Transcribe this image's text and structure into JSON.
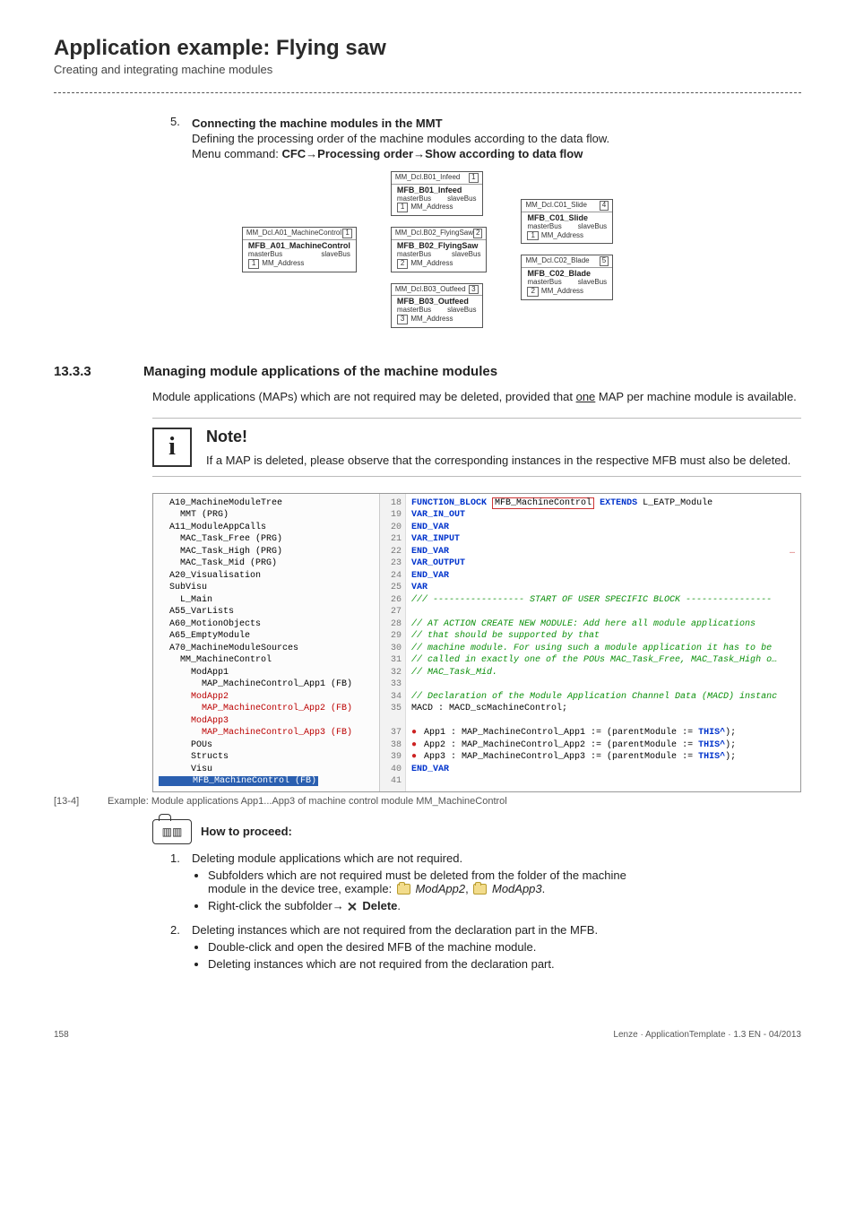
{
  "header": {
    "title": "Application example: Flying saw",
    "subtitle": "Creating and integrating machine modules"
  },
  "steps": {
    "step5": {
      "num": "5.",
      "title": "Connecting the machine modules in the MMT",
      "line1": "Defining the processing order of the machine modules according to the data flow.",
      "line2_prefix": "Menu command: ",
      "line2_cmd": "CFC→Processing order→Show according to data flow"
    }
  },
  "diagram": {
    "blocks": [
      {
        "decl": "MM_Dcl.A01_MachineControl",
        "name": "MFB_A01_MachineControl",
        "idx": "1",
        "addr": "1"
      },
      {
        "decl": "MM_Dcl.B01_Infeed",
        "name": "MFB_B01_Infeed",
        "idx": "1",
        "addr": "1"
      },
      {
        "decl": "MM_Dcl.B02_FlyingSaw",
        "name": "MFB_B02_FlyingSaw",
        "idx": "2",
        "addr": "2"
      },
      {
        "decl": "MM_Dcl.B03_Outfeed",
        "name": "MFB_B03_Outfeed",
        "idx": "3",
        "addr": "3"
      },
      {
        "decl": "MM_Dcl.C01_Slide",
        "name": "MFB_C01_Slide",
        "idx": "4",
        "addr": "1"
      },
      {
        "decl": "MM_Dcl.C02_Blade",
        "name": "MFB_C02_Blade",
        "idx": "5",
        "addr": "2"
      }
    ],
    "port_left": "masterBus",
    "port_right": "slaveBus",
    "port_addr": "MM_Address"
  },
  "section": {
    "num": "13.3.3",
    "title": "Managing module applications of the machine modules",
    "body": "Module applications (MAPs) which are not required may be deleted, provided that one MAP per machine module is available."
  },
  "note": {
    "title": "Note!",
    "body": "If a MAP is deleted, please observe that the corresponding instances in the respective MFB must also be deleted."
  },
  "code_screenshot": {
    "tree": [
      "  A10_MachineModuleTree",
      "    MMT (PRG)",
      "  A11_ModuleAppCalls",
      "    MAC_Task_Free (PRG)",
      "    MAC_Task_High (PRG)",
      "    MAC_Task_Mid (PRG)",
      "  A20_Visualisation",
      "  SubVisu",
      "    L_Main",
      "  A55_VarLists",
      "  A60_MotionObjects",
      "  A65_EmptyModule",
      "  A70_MachineModuleSources",
      "    MM_MachineControl",
      "      ModApp1",
      "        MAP_MachineControl_App1 (FB)",
      "      ModApp2",
      "        MAP_MachineControl_App2 (FB)",
      "      ModApp3",
      "        MAP_MachineControl_App3 (FB)",
      "      POUs",
      "      Structs",
      "      Visu",
      "      MFB_MachineControl (FB)"
    ],
    "linenos": [
      "18",
      "19",
      "20",
      "21",
      "22",
      "23",
      "24",
      "25",
      "26",
      "27",
      "28",
      "29",
      "30",
      "31",
      "32",
      "33",
      "34",
      "35",
      "",
      "37",
      "38",
      "39",
      "40",
      "41"
    ],
    "code": [
      "FUNCTION_BLOCK MFB_MachineControl EXTENDS L_EATP_Module",
      "VAR_IN_OUT",
      "END_VAR",
      "VAR_INPUT",
      "END_VAR",
      "VAR_OUTPUT",
      "END_VAR",
      "VAR",
      "    /// ----------------- START OF USER SPECIFIC BLOCK  ----------------",
      "",
      "    //  AT ACTION CREATE NEW MODULE: Add here all module applications",
      "    //  that should be supported by that",
      "    //  machine module. For using such a module application it has to be",
      "    //  called in exactly one of the POUs MAC_Task_Free, MAC_Task_High o…",
      "    //  MAC_Task_Mid.",
      "",
      "    // Declaration of the Module Application Channel Data (MACD) instanc",
      "    MACD : MACD_scMachineControl;",
      "",
      "    App1      : MAP_MachineControl_App1 := (parentModule := THIS^);",
      "    App2      : MAP_MachineControl_App2 := (parentModule := THIS^);",
      "    App3      : MAP_MachineControl_App3 := (parentModule := THIS^);",
      "END_VAR",
      ""
    ],
    "right_marks": "…"
  },
  "figure_caption": {
    "tag": "[13-4]",
    "text": "Example: Module applications App1...App3 of machine control module MM_MachineControl"
  },
  "howto": {
    "title": "How to proceed:"
  },
  "proc": {
    "step1": {
      "num": "1.",
      "text": "Deleting module applications which are not required.",
      "bullet1a": "Subfolders which are not required must be deleted from the folder of the machine",
      "bullet1b_pre": "module in the device tree, example: ",
      "bullet1b_m2": "ModApp2",
      "bullet1b_sep": ", ",
      "bullet1b_m3": "ModApp3",
      "bullet1b_end": ".",
      "bullet2_pre": "Right-click the subfolder→",
      "bullet2_del": "Delete",
      "bullet2_end": "."
    },
    "step2": {
      "num": "2.",
      "text": "Deleting instances which are not required from the declaration part in the MFB.",
      "bullet1": "Double-click and open the desired MFB of the machine module.",
      "bullet2": "Deleting instances which are not required from the declaration part."
    }
  },
  "footer": {
    "page": "158",
    "right": "Lenze · ApplicationTemplate · 1.3 EN - 04/2013"
  }
}
